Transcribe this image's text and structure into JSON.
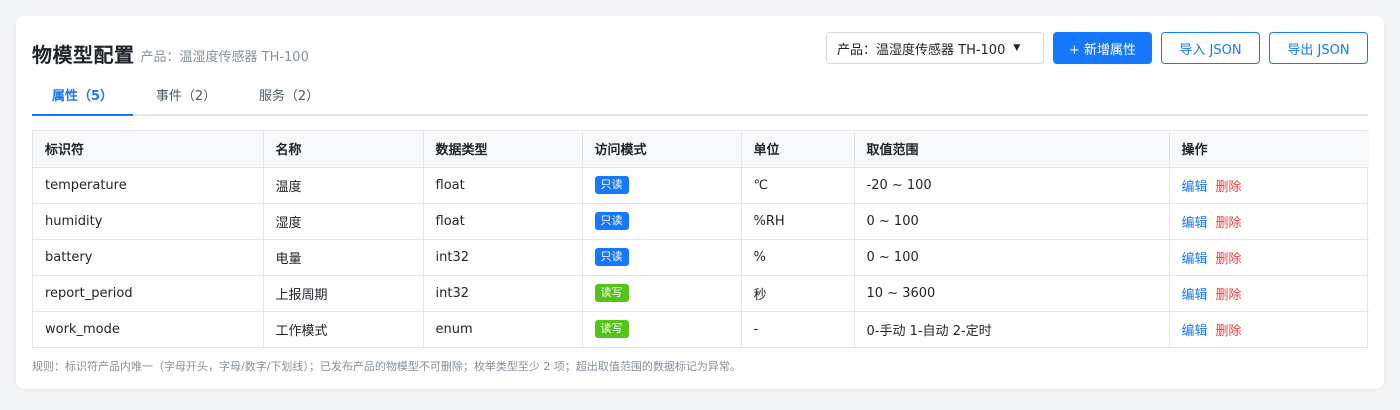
{
  "header": {
    "title": "物模型配置",
    "subtitle": "产品：温湿度传感器 TH-100",
    "product_select": "产品：温湿度传感器 TH-100",
    "add_button": "+ 新增属性",
    "import_button": "导入 JSON",
    "export_button": "导出 JSON"
  },
  "tabs": [
    {
      "label": "属性（5）"
    },
    {
      "label": "事件（2）"
    },
    {
      "label": "服务（2）"
    }
  ],
  "table": {
    "columns": [
      "标识符",
      "名称",
      "数据类型",
      "访问模式",
      "单位",
      "取值范围",
      "操作"
    ],
    "rows": [
      {
        "id": "temperature",
        "name": "温度",
        "type": "float",
        "access": "只读",
        "access_kind": "ro",
        "unit": "℃",
        "range": "-20 ~ 100",
        "edit": "编辑",
        "delete": "删除"
      },
      {
        "id": "humidity",
        "name": "湿度",
        "type": "float",
        "access": "只读",
        "access_kind": "ro",
        "unit": "%RH",
        "range": "0 ~ 100",
        "edit": "编辑",
        "delete": "删除"
      },
      {
        "id": "battery",
        "name": "电量",
        "type": "int32",
        "access": "只读",
        "access_kind": "ro",
        "unit": "%",
        "range": "0 ~ 100",
        "edit": "编辑",
        "delete": "删除"
      },
      {
        "id": "report_period",
        "name": "上报周期",
        "type": "int32",
        "access": "读写",
        "access_kind": "rw",
        "unit": "秒",
        "range": "10 ~ 3600",
        "edit": "编辑",
        "delete": "删除"
      },
      {
        "id": "work_mode",
        "name": "工作模式",
        "type": "enum",
        "access": "读写",
        "access_kind": "rw",
        "unit": "-",
        "range": "0-手动 1-自动 2-定时",
        "edit": "编辑",
        "delete": "删除"
      }
    ]
  },
  "footnote": "规则：标识符产品内唯一（字母开头，字母/数字/下划线）；已发布产品的物模型不可删除；枚举类型至少 2 项；超出取值范围的数据标记为异常。",
  "colors": {
    "primary": "#1677ff",
    "readonly_badge": "#1677ff",
    "readwrite_badge": "#52c41a",
    "delete_link": "#f53f3f"
  }
}
